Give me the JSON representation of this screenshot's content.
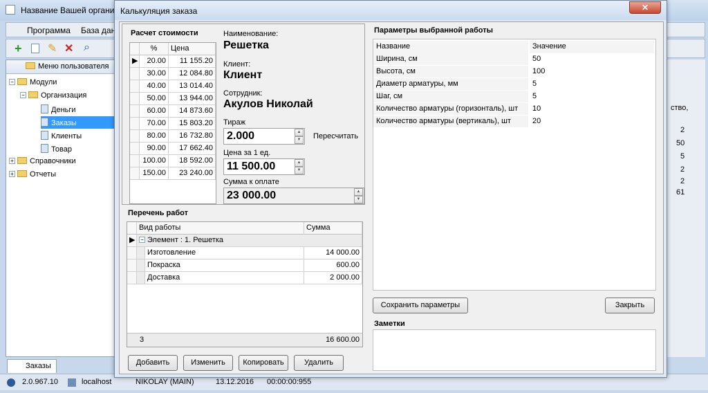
{
  "bg": {
    "title": "Название Вашей организ",
    "menu": [
      "Программа",
      "База дан"
    ],
    "tree_header": "Меню пользователя",
    "tree": [
      "Модули",
      "Организация",
      "Деньги",
      "Заказы",
      "Клиенты",
      "Товар",
      "Справочники",
      "Отчеты"
    ],
    "right_values": [
      "ство,",
      "2",
      "50",
      "5",
      "2",
      "2",
      "61"
    ],
    "tab": "Заказы",
    "status": {
      "version": "2.0.967.10",
      "host": "localhost",
      "user": "NIKOLAY (MAIN)",
      "date": "13.12.2016",
      "time": "00:00:00:955"
    }
  },
  "dialog": {
    "title": "Калькуляция заказа",
    "calc": {
      "title": "Расчет стоимости",
      "headers": [
        "%",
        "Цена"
      ],
      "rows": [
        [
          "20.00",
          "11 155.20"
        ],
        [
          "30.00",
          "12 084.80"
        ],
        [
          "40.00",
          "13 014.40"
        ],
        [
          "50.00",
          "13 944.00"
        ],
        [
          "60.00",
          "14 873.60"
        ],
        [
          "70.00",
          "15 803.20"
        ],
        [
          "80.00",
          "16 732.80"
        ],
        [
          "90.00",
          "17 662.40"
        ],
        [
          "100.00",
          "18 592.00"
        ],
        [
          "150.00",
          "23 240.00"
        ]
      ]
    },
    "info": {
      "name_label": "Наименование:",
      "name": "Решетка",
      "client_label": "Клиент:",
      "client": "Клиент",
      "employee_label": "Сотрудник:",
      "employee": "Акулов Николай",
      "qty_label": "Тираж",
      "qty": "2.000",
      "recalc": "Пересчитать",
      "price_label": "Цена за 1 ед.",
      "price": "11 500.00",
      "sum_label": "Сумма к оплате",
      "sum": "23 000.00"
    },
    "works": {
      "title": "Перечень работ",
      "headers": [
        "Вид работы",
        "Сумма"
      ],
      "group": "Элемент : 1. Решетка",
      "rows": [
        [
          "Изготовление",
          "14 000.00"
        ],
        [
          "Покраска",
          "600.00"
        ],
        [
          "Доставка",
          "2 000.00"
        ]
      ],
      "footer_count": "3",
      "footer_sum": "16 600.00"
    },
    "params": {
      "title": "Параметры выбранной работы",
      "headers": [
        "Название",
        "Значение"
      ],
      "rows": [
        [
          "Ширина, см",
          "50"
        ],
        [
          "Высота, см",
          "100"
        ],
        [
          "Диаметр арматуры, мм",
          "5"
        ],
        [
          "Шаг, см",
          "5"
        ],
        [
          "Количество арматуры (горизонталь), шт",
          "10"
        ],
        [
          "Количество арматуры (вертикаль), шт",
          "20"
        ]
      ]
    },
    "buttons": {
      "add": "Добавить",
      "edit": "Изменить",
      "copy": "Копировать",
      "delete": "Удалить",
      "save_params": "Сохранить параметры",
      "close": "Закрыть"
    },
    "notes_label": "Заметки"
  }
}
